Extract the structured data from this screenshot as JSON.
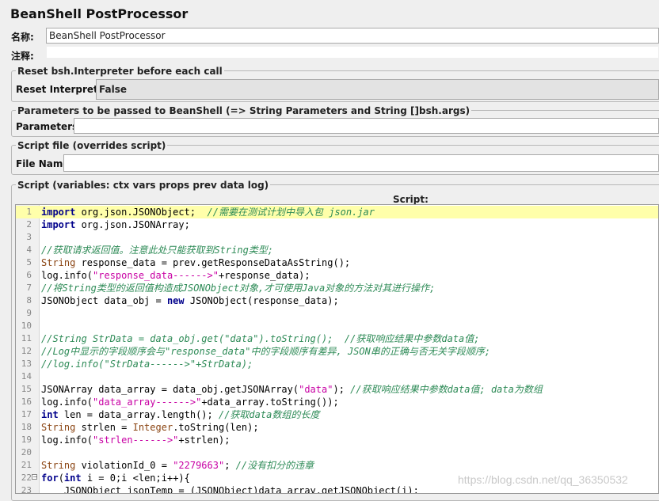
{
  "panel": {
    "title": "BeanShell PostProcessor"
  },
  "name_field": {
    "label": "名称:",
    "value": "BeanShell PostProcessor"
  },
  "comment_field": {
    "label": "注释:",
    "value": ""
  },
  "reset_group": {
    "legend": "Reset bsh.Interpreter before each call",
    "label": "Reset Interpreter:",
    "value": "False"
  },
  "params_group": {
    "legend": "Parameters to be passed to BeanShell (=> String Parameters and String []bsh.args)",
    "label": "Parameters:",
    "value": ""
  },
  "file_group": {
    "legend": "Script file (overrides script)",
    "label": "File Name:",
    "value": ""
  },
  "script_group": {
    "legend": "Script (variables: ctx vars props prev data log)",
    "header": "Script:"
  },
  "code_lines": [
    {
      "n": "1",
      "text": "import org.json.JSONObject;  //需要在测试计划中导入包 json.jar"
    },
    {
      "n": "2",
      "text": "import org.json.JSONArray;"
    },
    {
      "n": "3",
      "text": ""
    },
    {
      "n": "4",
      "text": "//获取请求返回值。注意此处只能获取到String类型;"
    },
    {
      "n": "5",
      "text": "String response_data = prev.getResponseDataAsString();"
    },
    {
      "n": "6",
      "text": "log.info(\"response_data------>\"+response_data);"
    },
    {
      "n": "7",
      "text": "//将String类型的返回值构造成JSONObject对象,才可使用Java对象的方法对其进行操作;"
    },
    {
      "n": "8",
      "text": "JSONObject data_obj = new JSONObject(response_data);"
    },
    {
      "n": "9",
      "text": ""
    },
    {
      "n": "10",
      "text": ""
    },
    {
      "n": "11",
      "text": "//String StrData = data_obj.get(\"data\").toString();  //获取响应结果中参数data值;"
    },
    {
      "n": "12",
      "text": "//Log中显示的字段顺序会与\"response_data\"中的字段顺序有差异, JSON串的正确与否无关字段顺序;"
    },
    {
      "n": "13",
      "text": "//log.info(\"StrData------>\"+StrData);"
    },
    {
      "n": "14",
      "text": ""
    },
    {
      "n": "15",
      "text": "JSONArray data_array = data_obj.getJSONArray(\"data\"); //获取响应结果中参数data值; data为数组"
    },
    {
      "n": "16",
      "text": "log.info(\"data_array------>\"+data_array.toString());"
    },
    {
      "n": "17",
      "text": "int len = data_array.length(); //获取data数组的长度"
    },
    {
      "n": "18",
      "text": "String strlen = Integer.toString(len);"
    },
    {
      "n": "19",
      "text": "log.info(\"strlen------>\"+strlen);"
    },
    {
      "n": "20",
      "text": ""
    },
    {
      "n": "21",
      "text": "String violationId_0 = \"2279663\"; //没有扣分的违章"
    },
    {
      "n": "22",
      "text": "for(int i = 0;i <len;i++){"
    },
    {
      "n": "23",
      "text": "    JSONObject jsonTemp = (JSONObject)data_array.getJSONObject(i);"
    }
  ],
  "watermark": "https://blog.csdn.net/qq_36350532"
}
